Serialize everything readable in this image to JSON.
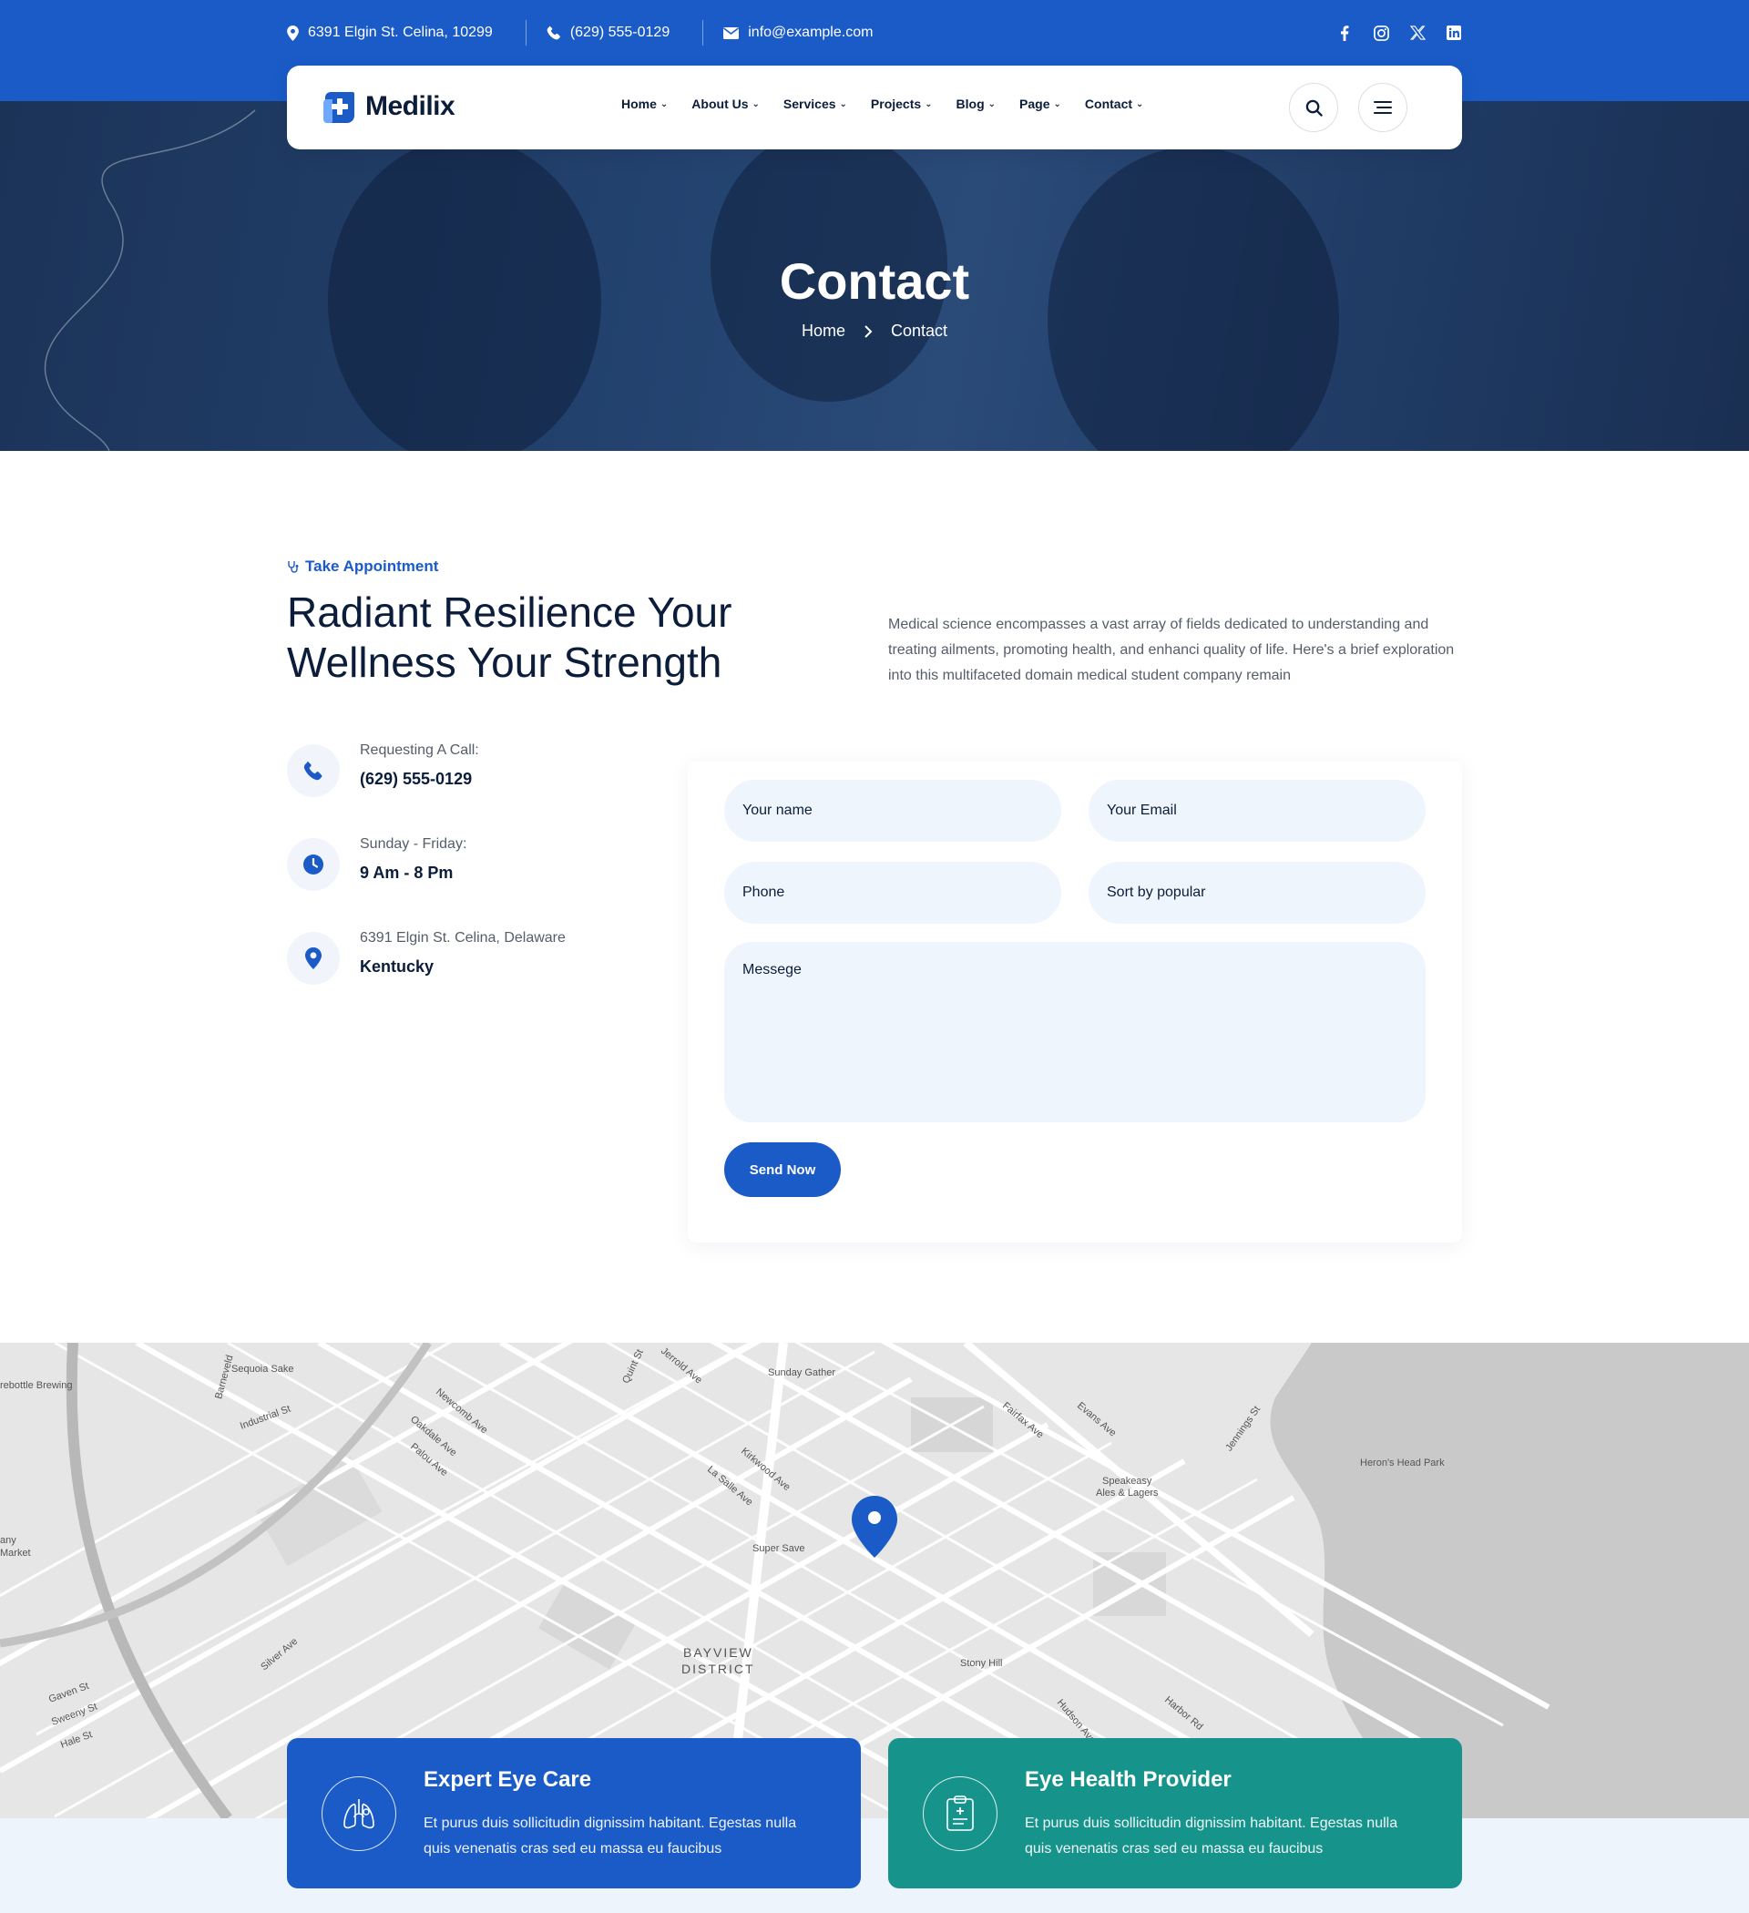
{
  "topbar": {
    "address": "6391 Elgin St. Celina, 10299",
    "phone": "(629) 555-0129",
    "email": "info@example.com",
    "socials": [
      "facebook-icon",
      "instagram-icon",
      "x-icon",
      "linkedin-icon"
    ]
  },
  "brand": {
    "name": "Medilix"
  },
  "nav": {
    "items": [
      "Home",
      "About Us",
      "Services",
      "Projects",
      "Blog",
      "Page",
      "Contact"
    ]
  },
  "hero": {
    "title": "Contact",
    "breadcrumb": {
      "home": "Home",
      "current": "Contact"
    }
  },
  "appointment": {
    "tag": "Take Appointment",
    "heading": "Radiant Resilience Your Wellness Your Strength",
    "description": "Medical science encompasses a vast array of fields dedicated to understanding and treating ailments, promoting health, and enhanci quality of life. Here's a brief exploration into this multifaceted domain medical student company remain"
  },
  "contact_info": [
    {
      "icon": "phone-icon",
      "label": "Requesting A Call:",
      "value": "(629) 555-0129"
    },
    {
      "icon": "clock-icon",
      "label": "Sunday - Friday:",
      "value": "9 Am - 8 Pm"
    },
    {
      "icon": "location-pin-icon",
      "label": "6391 Elgin St. Celina, Delaware",
      "value": "Kentucky"
    }
  ],
  "form": {
    "name_placeholder": "Your name",
    "email_placeholder": "Your Email",
    "phone_placeholder": "Phone",
    "sort_value": "Sort by popular",
    "message_placeholder": "Messege",
    "submit_label": "Send Now"
  },
  "map": {
    "labels": {
      "district": "BAYVIEW DISTRICT",
      "places": [
        "Sequoia Sake",
        "Sunday Gather",
        "Super Save",
        "Speakeasy Ales & Lagers",
        "Heron's Head Park",
        "Stony Hill",
        "Market",
        "rebottle Brewing"
      ],
      "streets": [
        "Industrial St",
        "Newcomb Ave",
        "Oakdale Ave",
        "Palou Ave",
        "Jerrold Ave",
        "Quint St",
        "Kirkwood Ave",
        "La Salle Ave",
        "Fairfax Ave",
        "Evans Ave",
        "Jennings St",
        "Silver Ave",
        "Gaven St",
        "Sweeny St",
        "Hale St",
        "Hudson Ave",
        "Harbor Rd",
        "Barneveld"
      ]
    }
  },
  "features": [
    {
      "icon": "lungs-icon",
      "title": "Expert Eye Care",
      "text": "Et purus duis sollicitudin dignissim habitant. Egestas nulla quis venenatis cras sed eu massa eu faucibus",
      "color": "#1a5bc8"
    },
    {
      "icon": "clipboard-medical-icon",
      "title": "Eye Health Provider",
      "text": "Et purus duis sollicitudin dignissim habitant. Egestas nulla quis venenatis cras sed eu massa eu faucibus",
      "color": "#16948b"
    }
  ],
  "colors": {
    "primary": "#1a5bc8",
    "teal": "#16948b",
    "dark": "#0b1d3a",
    "field_bg": "#eff5fd"
  }
}
